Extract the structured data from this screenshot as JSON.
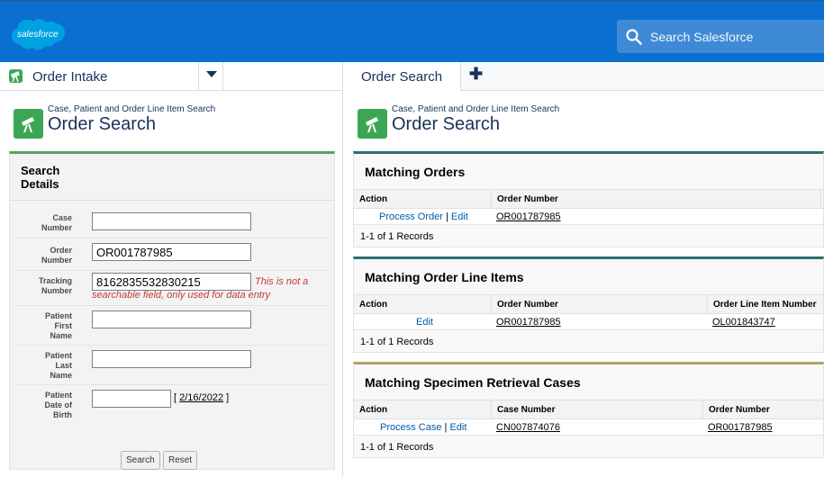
{
  "header": {
    "logo_text": "salesforce",
    "search_placeholder": "Search Salesforce",
    "brand_color": "#0a6fd1"
  },
  "app": {
    "name": "Order Intake",
    "tab_label": "Order Search"
  },
  "page_header": {
    "subtitle": "Case, Patient and Order Line Item Search",
    "title": "Order Search"
  },
  "search_details": {
    "title": "Search Details",
    "fields": [
      {
        "label": "Case Number",
        "value": ""
      },
      {
        "label": "Order Number",
        "value": "OR001787985"
      },
      {
        "label": "Tracking Number",
        "value": "8162835532830215",
        "note": "This is not a searchable field, only used for data entry"
      },
      {
        "label": "Patient First Name",
        "value": ""
      },
      {
        "label": "Patient Last Name",
        "value": ""
      },
      {
        "label": "Patient Date of Birth",
        "value": "",
        "date_link": "2/16/2022"
      }
    ],
    "search_button": "Search",
    "reset_button": "Reset"
  },
  "matching_orders": {
    "title": "Matching Orders",
    "columns": [
      "Action",
      "Order Number"
    ],
    "rows": [
      {
        "action1": "Process Order",
        "action2": "Edit",
        "order_number": "OR001787985"
      }
    ],
    "footer": "1-1 of 1 Records"
  },
  "matching_line_items": {
    "title": "Matching Order Line Items",
    "columns": [
      "Action",
      "Order Number",
      "Order Line Item Number"
    ],
    "rows": [
      {
        "action": "Edit",
        "order_number": "OR001787985",
        "line_item_number": "OL001843747"
      }
    ],
    "footer": "1-1 of 1 Records"
  },
  "matching_cases": {
    "title": "Matching Specimen Retrieval Cases",
    "columns": [
      "Action",
      "Case Number",
      "Order Number"
    ],
    "rows": [
      {
        "action1": "Process Case",
        "action2": "Edit",
        "case_number": "CN007874076",
        "order_number": "OR001787985"
      }
    ],
    "footer": "1-1 of 1 Records"
  }
}
